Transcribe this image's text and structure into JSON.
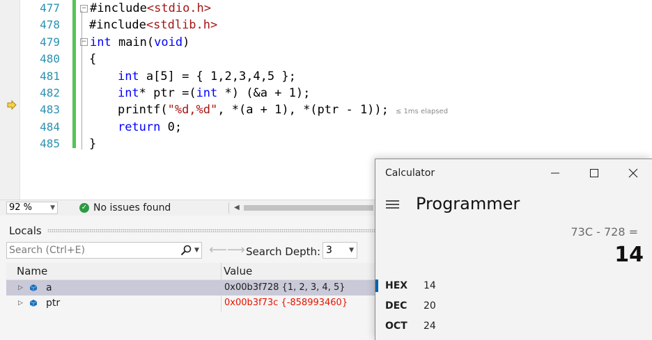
{
  "editor": {
    "line_numbers": [
      "477",
      "478",
      "479",
      "480",
      "481",
      "482",
      "483",
      "484",
      "485"
    ],
    "current_line_marker": "arrow-icon",
    "elapsed_text": "≤ 1ms elapsed"
  },
  "status_bar": {
    "zoom": "92 %",
    "issues": "No issues found"
  },
  "locals": {
    "title": "Locals",
    "search_placeholder": "Search (Ctrl+E)",
    "search_depth_label": "Search Depth:",
    "search_depth_value": "3",
    "columns": {
      "name": "Name",
      "value": "Value"
    },
    "rows": [
      {
        "name": "a",
        "value": "0x00b3f728 {1, 2, 3, 4, 5}",
        "selected": true,
        "changed": false
      },
      {
        "name": "ptr",
        "value": "0x00b3f73c {-858993460}",
        "selected": false,
        "changed": true
      }
    ]
  },
  "calculator": {
    "window_title": "Calculator",
    "mode": "Programmer",
    "expression": "73C - 728 =",
    "result": "14",
    "radix": [
      {
        "label": "HEX",
        "value": "14",
        "active": true
      },
      {
        "label": "DEC",
        "value": "20",
        "active": false
      },
      {
        "label": "OCT",
        "value": "24",
        "active": false
      }
    ],
    "accent_color": "#0063b1"
  },
  "colors": {
    "keyword": "#0000ff",
    "string": "#a31515",
    "line_number": "#2b91af",
    "change_bar": "#57c356",
    "changed_value": "#e51400"
  }
}
